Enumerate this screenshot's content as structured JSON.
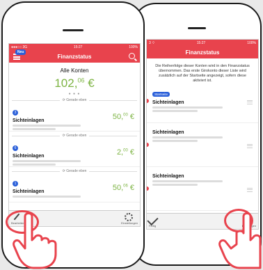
{
  "left": {
    "status": {
      "carrier": "●●●○○ 3G",
      "time": "15:27",
      "battery": "100%"
    },
    "nav": {
      "title": "Finanzstatus",
      "badge": "Neu"
    },
    "overview": {
      "heading": "Alle Konten",
      "total_int": "102,",
      "total_dec": "06",
      "currency": "€",
      "dots": "● ● ●"
    },
    "refresh_label": "Gerade eben",
    "accounts": [
      {
        "num": "3",
        "name": "Sichteinlagen",
        "int": "50,",
        "dec": "00",
        "currency": "€"
      },
      {
        "num": "6",
        "name": "Sichteinlagen",
        "int": "2,",
        "dec": "00",
        "currency": "€"
      },
      {
        "num": "1",
        "name": "Sichteinlagen",
        "int": "50,",
        "dec": "06",
        "currency": "€"
      }
    ],
    "bottom": {
      "edit": "Bearbeiten",
      "settings": "Einstellungen"
    }
  },
  "right": {
    "status": {
      "carrier": "3 ⌔",
      "time": "15:27",
      "battery": "100%"
    },
    "nav": {
      "title": "Finanzstatus"
    },
    "description": "Die Reihenfolge dieser Konten wird in den Finanzstatus übernommen. Das erste Girokonto dieser Liste wird zusätzlich auf der Startseite angezeigt, sofern diese aktiviert ist.",
    "tag": "Startseite",
    "rows": [
      {
        "name": "Sichteinlagen"
      },
      {
        "name": "Sichteinlagen"
      },
      {
        "name": "Sichteinlagen"
      }
    ],
    "bottom": {
      "done": "Fertig",
      "add": "Hinzufügen"
    }
  },
  "colors": {
    "accent": "#e8434d",
    "positive": "#7cb342",
    "badge": "#2a5fd9"
  }
}
